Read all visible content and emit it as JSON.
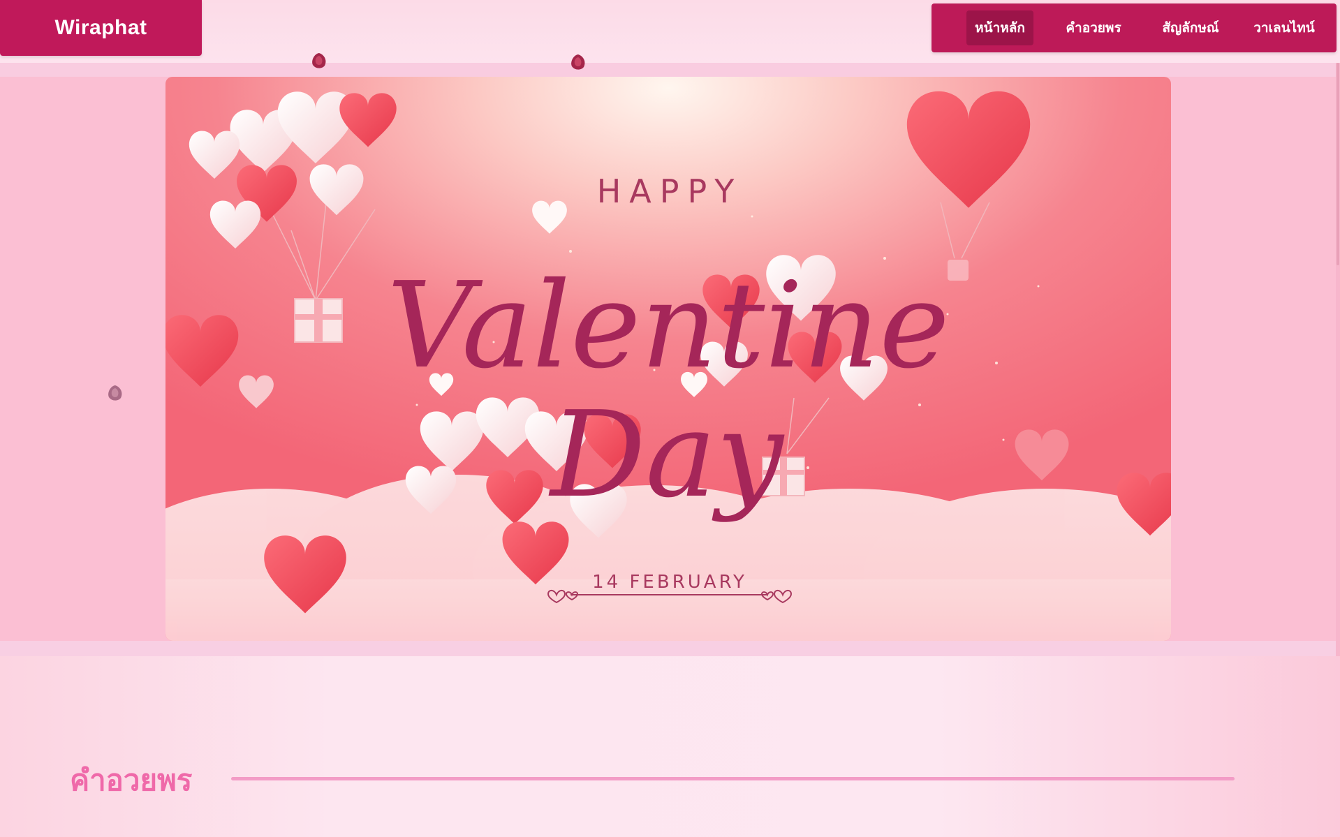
{
  "logo": {
    "text": "Wiraphat"
  },
  "nav": {
    "items": [
      {
        "label": "หน้าหลัก",
        "active": true
      },
      {
        "label": "คำอวยพร",
        "active": false
      },
      {
        "label": "สัญลักษณ์",
        "active": false
      },
      {
        "label": "วาเลนไทน์",
        "active": false
      }
    ]
  },
  "hero": {
    "happy": "HAPPY",
    "valentine": "Valentine",
    "day": "Day",
    "date": "14 FEBRUARY"
  },
  "section": {
    "title": "คำอวยพร"
  },
  "colors": {
    "primary": "#bd1a58",
    "nav_active": "#9c1449",
    "heading_pink": "#ef69a9",
    "hero_script": "#a52659",
    "heart_red": "#f4505f"
  },
  "icons": [
    "heart-icon",
    "gift-box-icon",
    "rose-petal-icon"
  ]
}
